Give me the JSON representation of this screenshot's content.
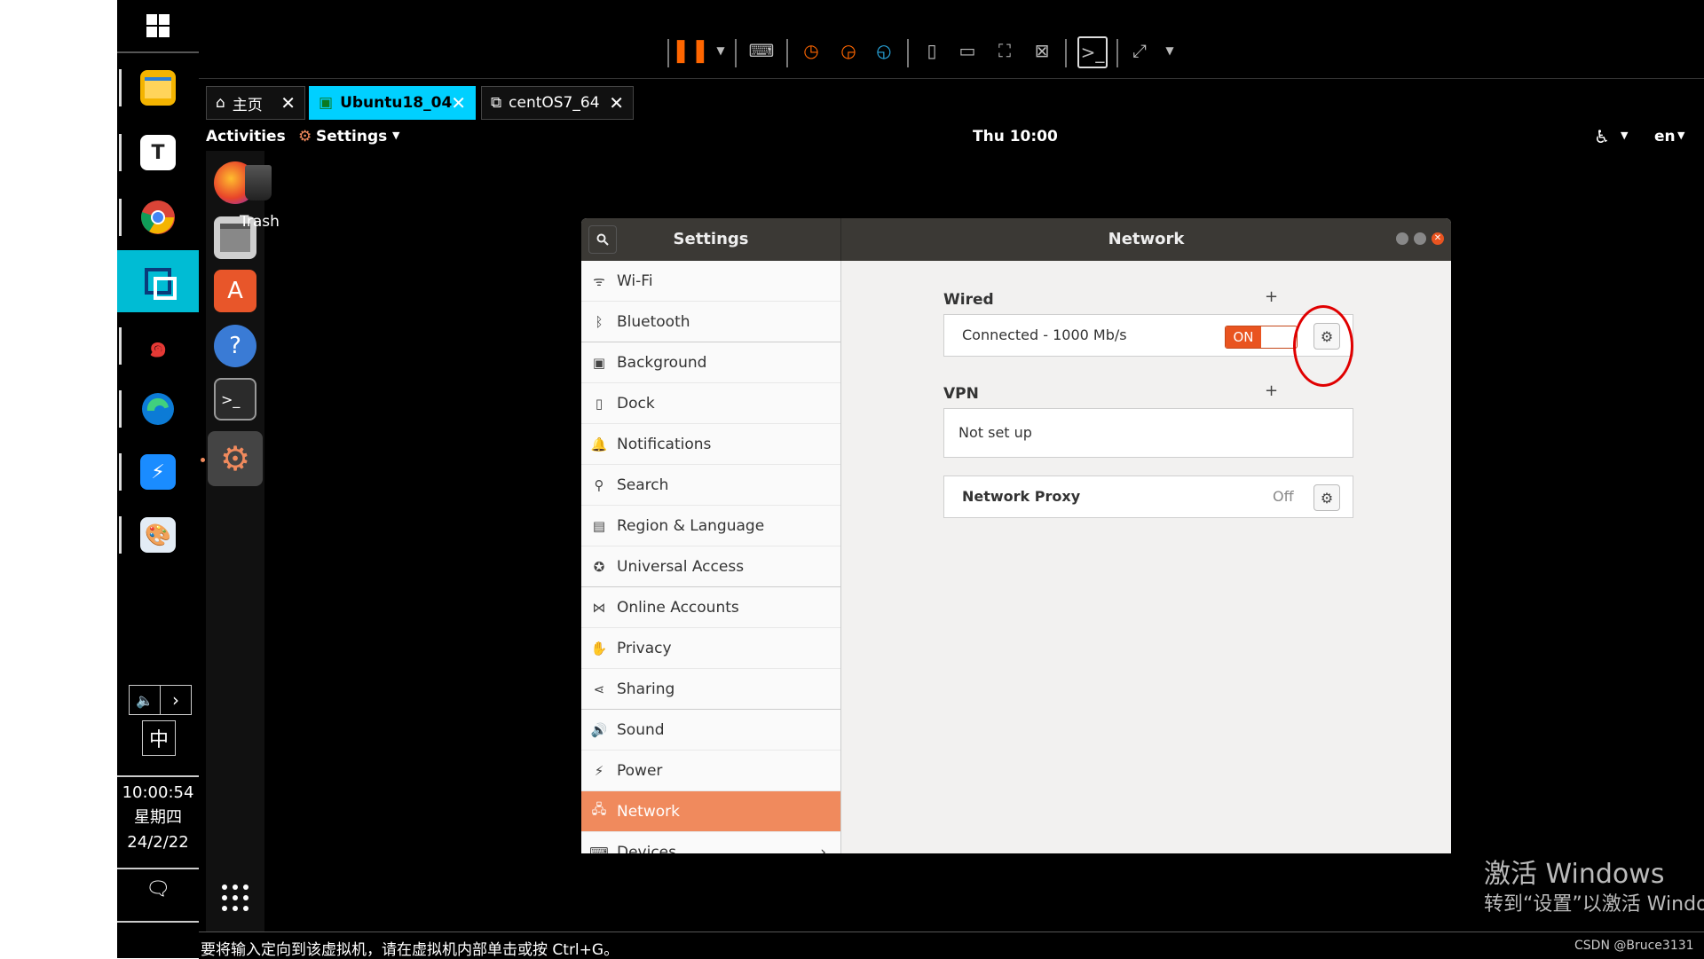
{
  "windows_taskbar": {
    "apps": [
      {
        "name": "start",
        "icon": "windows-logo-icon"
      },
      {
        "name": "file-explorer",
        "icon": "folder-icon"
      },
      {
        "name": "typora",
        "icon": "typora-icon",
        "label": "T"
      },
      {
        "name": "chrome",
        "icon": "chrome-icon"
      },
      {
        "name": "vmware",
        "icon": "vmware-icon"
      },
      {
        "name": "app-swirl",
        "icon": "swirl-icon"
      },
      {
        "name": "edge",
        "icon": "edge-icon"
      },
      {
        "name": "app-blue",
        "icon": "lightning-icon"
      },
      {
        "name": "paint",
        "icon": "palette-icon"
      }
    ],
    "ime_label": "中",
    "clock": {
      "time": "10:00:54",
      "weekday": "星期四",
      "date": "24/2/22"
    }
  },
  "vmware": {
    "tabs": [
      {
        "label": "主页",
        "icon": "home-icon"
      },
      {
        "label": "Ubuntu18_04",
        "icon": "vm-play-icon"
      },
      {
        "label": "centOS7_64",
        "icon": "vm-icon"
      }
    ],
    "status_message": "要将输入定向到该虚拟机，请在虚拟机内部单击或按 Ctrl+G。"
  },
  "ubuntu_topbar": {
    "activities": "Activities",
    "app_menu": "Settings",
    "clock": "Thu 10:00",
    "language": "en"
  },
  "desktop": {
    "trash_label": "Trash"
  },
  "settings": {
    "sidebar_title": "Settings",
    "panel_title": "Network",
    "sidebar_items": [
      {
        "label": "Wi-Fi",
        "icon": "wifi-icon"
      },
      {
        "label": "Bluetooth",
        "icon": "bluetooth-icon"
      },
      {
        "label": "Background",
        "icon": "background-icon"
      },
      {
        "label": "Dock",
        "icon": "dock-icon"
      },
      {
        "label": "Notifications",
        "icon": "bell-icon"
      },
      {
        "label": "Search",
        "icon": "search-icon"
      },
      {
        "label": "Region & Language",
        "icon": "region-icon"
      },
      {
        "label": "Universal Access",
        "icon": "accessibility-icon"
      },
      {
        "label": "Online Accounts",
        "icon": "accounts-icon"
      },
      {
        "label": "Privacy",
        "icon": "hand-icon"
      },
      {
        "label": "Sharing",
        "icon": "share-icon"
      },
      {
        "label": "Sound",
        "icon": "speaker-icon"
      },
      {
        "label": "Power",
        "icon": "power-icon"
      },
      {
        "label": "Network",
        "icon": "network-icon"
      },
      {
        "label": "Devices",
        "icon": "devices-icon"
      }
    ],
    "active_item": "Network",
    "wired": {
      "title": "Wired",
      "status": "Connected - 1000 Mb/s",
      "toggle": "ON"
    },
    "vpn": {
      "title": "VPN",
      "status": "Not set up"
    },
    "proxy": {
      "label": "Network Proxy",
      "value": "Off"
    }
  },
  "watermark": {
    "line1": "激活 Windows",
    "line2": "转到“设置”以激活 Windo"
  },
  "credit": "CSDN @Bruce3131",
  "colors": {
    "accent": "#f08a5d",
    "toggle_on": "#e95420",
    "vmware_tab_active": "#00d0ff",
    "highlight_circle": "#e00000"
  }
}
